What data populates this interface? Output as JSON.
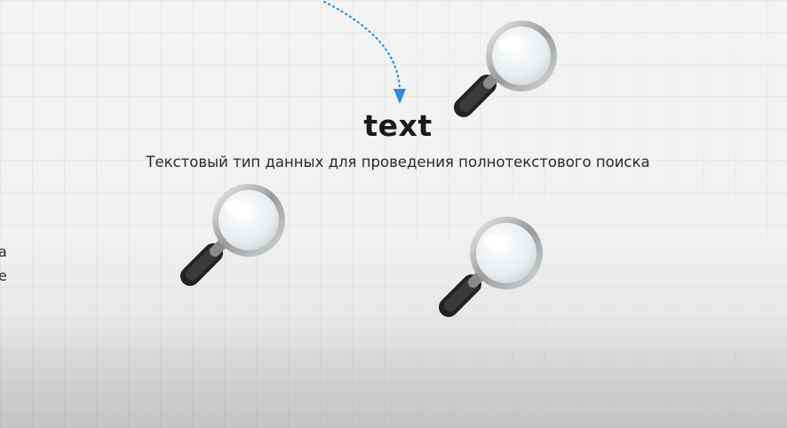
{
  "heading": "text",
  "description": "Текстовый тип данных для проведения полнотекстового поиска",
  "side_fragments": [
    "a",
    "e"
  ],
  "colors": {
    "arrow": "#2f8ae0",
    "heading": "#1a1a1a"
  },
  "icons": [
    "magnifier-icon",
    "magnifier-icon",
    "magnifier-icon",
    "dotted-arrow-icon"
  ]
}
